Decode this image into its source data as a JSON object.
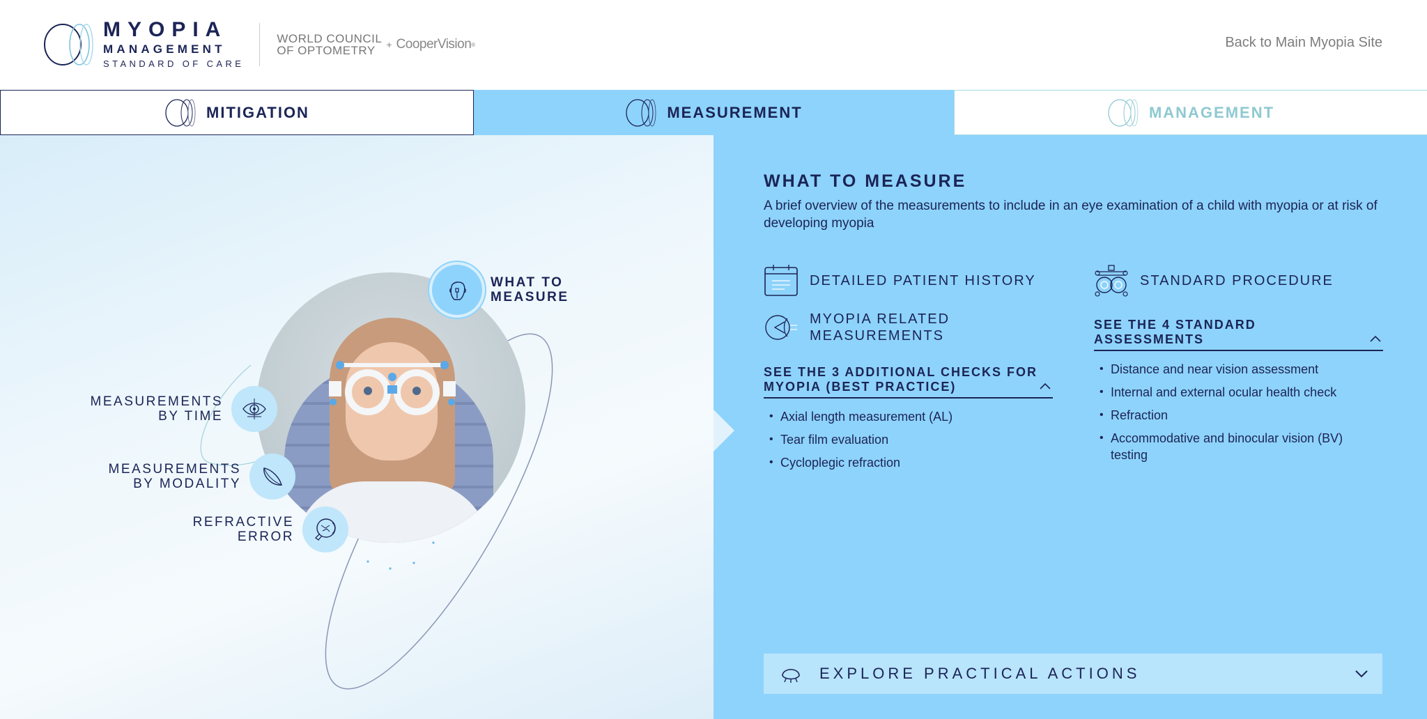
{
  "header": {
    "logo": {
      "line1": "MYOPIA",
      "line2": "MANAGEMENT",
      "line3": "STANDARD OF CARE"
    },
    "partner": {
      "org_line1": "WORLD COUNCIL",
      "org_line2": "OF OPTOMETRY",
      "plus": "+",
      "sponsor": "CooperVision",
      "sponsor_mark": "®"
    },
    "back_link": "Back to Main Myopia Site"
  },
  "tabs": [
    {
      "label": "MITIGATION",
      "active": false
    },
    {
      "label": "MEASUREMENT",
      "active": true
    },
    {
      "label": "MANAGEMENT",
      "active": false
    }
  ],
  "visual": {
    "nodes": {
      "what_to_measure": {
        "line1": "WHAT TO",
        "line2": "MEASURE",
        "icon": "face-measure-icon",
        "active": true
      },
      "by_time": {
        "line1": "MEASUREMENTS",
        "line2": "BY TIME",
        "icon": "eye-target-icon"
      },
      "by_modality": {
        "line1": "MEASUREMENTS",
        "line2": "BY MODALITY",
        "icon": "contact-lens-icon"
      },
      "refractive_error": {
        "line1": "REFRACTIVE",
        "line2": "ERROR",
        "icon": "eyeball-icon"
      }
    }
  },
  "content": {
    "title": "WHAT TO MEASURE",
    "description": "A brief overview of the measurements to include in an eye examination of a child with myopia or at risk of developing myopia",
    "left_column": {
      "category1": "DETAILED PATIENT HISTORY",
      "category2_line1": "MYOPIA RELATED",
      "category2_line2": "MEASUREMENTS",
      "accordion_line1": "SEE THE 3 ADDITIONAL CHECKS FOR",
      "accordion_line2": "MYOPIA (BEST PRACTICE)",
      "expanded": true,
      "items": [
        "Axial length measurement (AL)",
        "Tear film evaluation",
        "Cycloplegic refraction"
      ]
    },
    "right_column": {
      "category1": "STANDARD PROCEDURE",
      "accordion_line1": "SEE THE 4 STANDARD",
      "accordion_line2": "ASSESSMENTS",
      "expanded": true,
      "items": [
        "Distance and near vision assessment",
        "Internal and external ocular health check",
        "Refraction",
        "Accommodative and binocular vision (BV) testing"
      ]
    },
    "explore": {
      "label": "EXPLORE PRACTICAL ACTIONS",
      "expanded": false
    }
  },
  "colors": {
    "navy": "#1b2456",
    "accent_blue": "#8ed3fb",
    "light_blue": "#b8e4fc",
    "management_teal": "#8ec9d1",
    "link_gray": "#7d7d7d"
  }
}
